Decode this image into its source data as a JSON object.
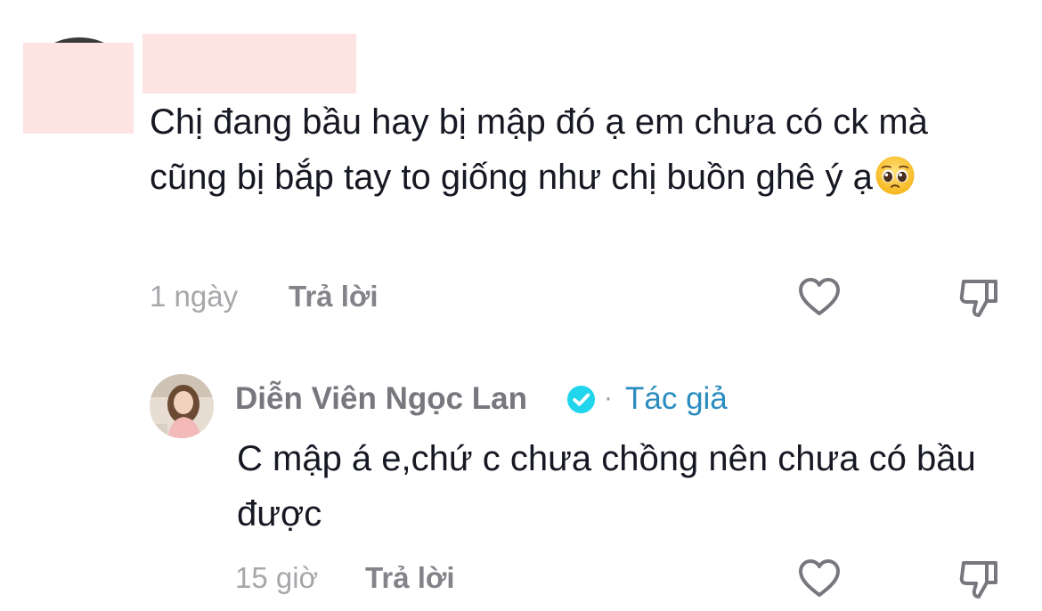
{
  "comment": {
    "text": "Chị đang bầu hay bị mập đó ạ em chưa có ck mà cũng bị bắp tay to giống như chị buồn ghê ý ạ",
    "emoji": "pleading-face-emoji",
    "time": "1 ngày",
    "reply_label": "Trả lời"
  },
  "reply": {
    "author": "Diễn Viên Ngọc Lan",
    "dot": "·",
    "author_tag": "Tác giả",
    "text": "C mập á e,chứ c chưa chồng nên chưa có bầu được",
    "time": "15 giờ",
    "reply_label": "Trả lời"
  },
  "icons": {
    "like": "heart-outline-icon",
    "dislike": "thumbs-down-icon",
    "verified": "verified-badge-icon"
  },
  "colors": {
    "verified": "#20d5ec",
    "author_tag": "#2a8cbf",
    "redaction": "#fde3e1"
  }
}
